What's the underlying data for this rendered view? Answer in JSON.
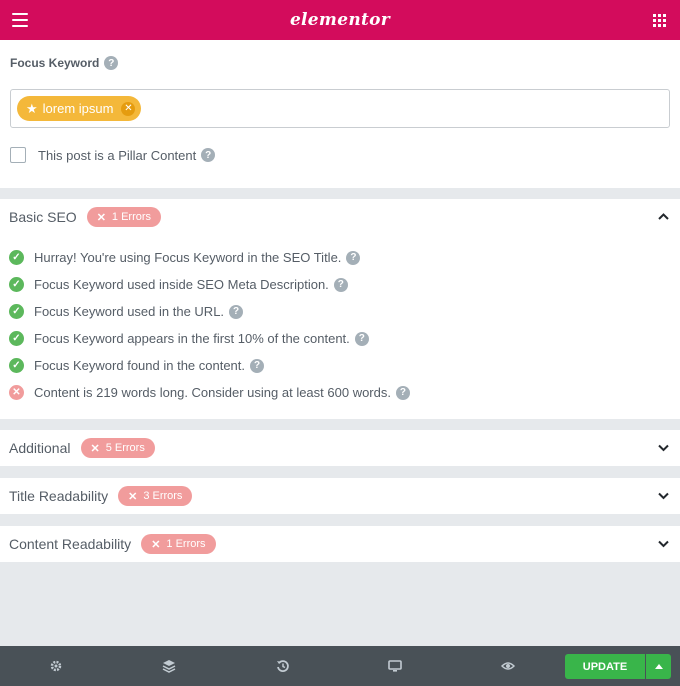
{
  "header": {
    "logo": "elementor",
    "menu_icon": "hamburger-icon",
    "apps_icon": "grid-icon",
    "accent": "#d30c5c"
  },
  "focus_keyword": {
    "label": "Focus Keyword",
    "help": "?",
    "tag_label": "lorem ipsum",
    "tag_color": "#f4b83a"
  },
  "pillar": {
    "label": "This post is a Pillar Content",
    "checked": false,
    "help": "?"
  },
  "basic_seo": {
    "title": "Basic SEO",
    "badge": "1 Errors",
    "expanded": true,
    "checks": [
      {
        "text": "Hurray! You're using Focus Keyword in the SEO Title.",
        "status": "pass"
      },
      {
        "text": "Focus Keyword used inside SEO Meta Description.",
        "status": "pass"
      },
      {
        "text": "Focus Keyword used in the URL.",
        "status": "pass"
      },
      {
        "text": "Focus Keyword appears in the first 10% of the content.",
        "status": "pass"
      },
      {
        "text": "Focus Keyword found in the content.",
        "status": "pass"
      },
      {
        "text": "Content is 219 words long. Consider using at least 600 words.",
        "status": "fail"
      }
    ]
  },
  "sections": [
    {
      "title": "Additional",
      "badge": "5 Errors"
    },
    {
      "title": "Title Readability",
      "badge": "3 Errors"
    },
    {
      "title": "Content Readability",
      "badge": "1 Errors"
    }
  ],
  "footer": {
    "icons": [
      "settings-icon",
      "layers-icon",
      "history-icon",
      "responsive-icon",
      "preview-icon"
    ],
    "update_label": "UPDATE",
    "update_color": "#39b54a"
  },
  "colors": {
    "pass": "#5cb85c",
    "error_badge": "#f19c9c"
  }
}
